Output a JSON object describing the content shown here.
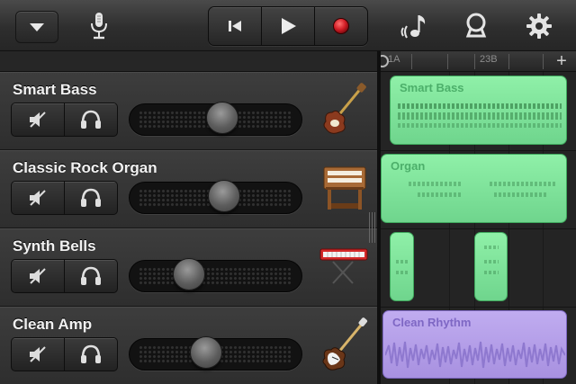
{
  "toolbar": {
    "icons": [
      "chevron-down-icon",
      "microphone-icon",
      "rewind-icon",
      "play-icon",
      "record-icon",
      "loops-icon",
      "smart-controls-icon",
      "gear-icon"
    ],
    "record_color": "#d01c24"
  },
  "ruler": {
    "marker_a": "1A",
    "marker_b": "23B",
    "add_label": "+"
  },
  "tracks": [
    {
      "name": "Smart Bass",
      "volume": 0.55,
      "instrument_icon": "bass-guitar-icon"
    },
    {
      "name": "Classic Rock Organ",
      "volume": 0.56,
      "instrument_icon": "organ-icon"
    },
    {
      "name": "Synth Bells",
      "volume": 0.31,
      "instrument_icon": "keyboard-synth-icon"
    },
    {
      "name": "Clean Amp",
      "volume": 0.43,
      "instrument_icon": "electric-guitar-icon"
    }
  ],
  "regions": [
    {
      "label": "Smart Bass",
      "color": "#7fe29a"
    },
    {
      "label": "Organ",
      "color": "#7fe29a"
    },
    {
      "label": "",
      "color": "#7fe29a"
    },
    {
      "label": "",
      "color": "#7fe29a"
    },
    {
      "label": "Clean Rhythm",
      "color": "#b7a2ea"
    }
  ]
}
